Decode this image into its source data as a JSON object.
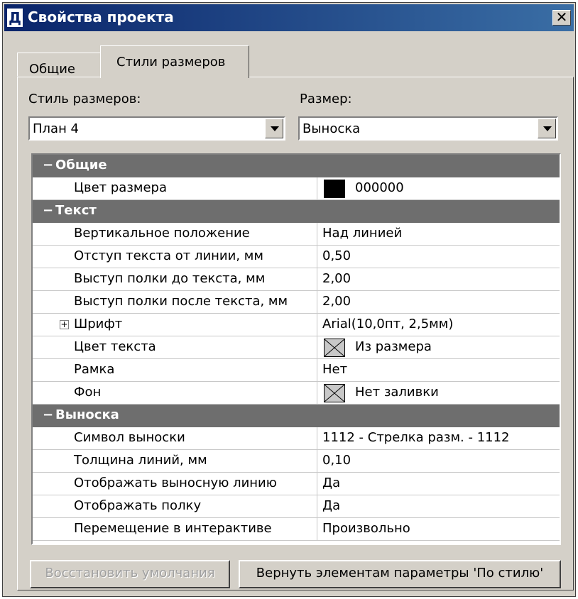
{
  "window": {
    "title": "Свойства проекта",
    "icon_glyph": "Д",
    "close_glyph": "✕"
  },
  "tabs": [
    {
      "label": "Общие",
      "active": false
    },
    {
      "label": "Стили размеров",
      "active": true
    }
  ],
  "style_field": {
    "label": "Стиль размеров:",
    "value": "План 4"
  },
  "size_field": {
    "label": "Размер:",
    "value": "Выноска"
  },
  "grid": {
    "groups": [
      {
        "title": "Общие",
        "toggle": "−"
      },
      {
        "title": "Текст",
        "toggle": "−"
      },
      {
        "title": "Выноска",
        "toggle": "−"
      }
    ],
    "general": [
      {
        "name": "Цвет размера",
        "value": "000000"
      }
    ],
    "text": [
      {
        "name": "Вертикальное положение",
        "value": "Над линией"
      },
      {
        "name": "Отступ текста от линии, мм",
        "value": "0,50"
      },
      {
        "name": "Выступ полки до текста, мм",
        "value": "2,00"
      },
      {
        "name": "Выступ полки после текста, мм",
        "value": "2,00"
      },
      {
        "name": "Шрифт",
        "value": "Arial(10,0пт, 2,5мм)"
      },
      {
        "name": "Цвет текста",
        "value": "Из размера"
      },
      {
        "name": "Рамка",
        "value": "Нет"
      },
      {
        "name": "Фон",
        "value": "Нет заливки"
      }
    ],
    "leader": [
      {
        "name": "Символ выноски",
        "value": "1112 - Стрелка разм. - 1112"
      },
      {
        "name": "Толщина линий, мм",
        "value": "0,10"
      },
      {
        "name": "Отображать выносную линию",
        "value": "Да"
      },
      {
        "name": "Отображать полку",
        "value": "Да"
      },
      {
        "name": "Перемещение в интерактиве",
        "value": "Произвольно"
      }
    ],
    "font_expander": "+"
  },
  "buttons": {
    "restore_defaults": {
      "label": "Восстановить умолчания",
      "enabled": false
    },
    "return_by_style": {
      "label": "Вернуть элементам параметры 'По стилю'",
      "enabled": true
    }
  },
  "colors": {
    "titlebar": "#0a246a",
    "dialog_bg": "#d4d0c8",
    "category_bg": "#6e6e6e",
    "size_color": "#000000"
  }
}
